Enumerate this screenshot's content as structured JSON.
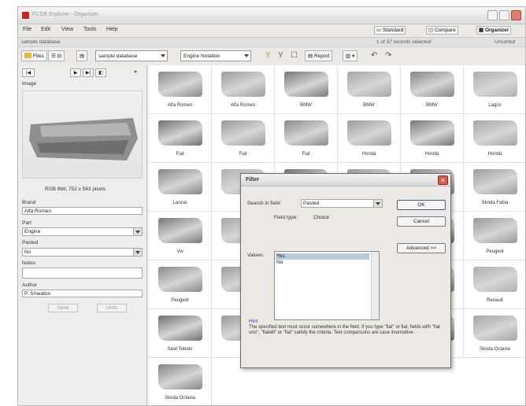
{
  "window": {
    "title": "FCDB Explorer - Organizer"
  },
  "menu": [
    "File",
    "Edit",
    "View",
    "Tools",
    "Help"
  ],
  "views": {
    "standard": "Standard",
    "compare": "Compare",
    "organizer": "Organizer"
  },
  "status": {
    "left": "sample database",
    "selection": "1 of 37 records selected",
    "sort": "Unsorted"
  },
  "toolbar": {
    "files_label": "Files",
    "db_combo": "sample database",
    "field_combo": "Engine Notation",
    "report_label": "Report"
  },
  "left": {
    "image_label": "Image",
    "image_info": "RGB 8bit, 752 x 543 pixels",
    "brand_label": "Brand",
    "brand_value": "Alfa Romeo",
    "part_label": "Part",
    "part_value": "Engine",
    "pasted_label": "Pasted",
    "pasted_value": "No",
    "notes_label": "Notes",
    "notes_value": "",
    "author_label": "Author",
    "author_value": "P. Smeaton",
    "save_label": "Save",
    "undo_label": "Undo"
  },
  "thumbnails": [
    "Alfa Romeo",
    "Alfa Romeo",
    "BMW",
    "BMW",
    "BMW",
    "Lagos",
    "Fiat",
    "Fiat",
    "Fiat",
    "Honda",
    "Honda",
    "Honda",
    "Lancia",
    "",
    "",
    "",
    "",
    "Skoda Fabia",
    "Vw",
    "Sk",
    "",
    "",
    "",
    "Peugeot",
    "Peugeot",
    "Sk",
    "",
    "",
    "",
    "Renault",
    "Seat Toledo",
    "Sk",
    "",
    "",
    "",
    "Skoda Octavia",
    "Skoda Octavia"
  ],
  "dialog": {
    "title": "Filter",
    "search_label": "Search in field:",
    "search_value": "Pasted",
    "field_type_label": "Field type:",
    "field_type_value": "Choice",
    "values_label": "Values:",
    "values": [
      "Yes",
      "No"
    ],
    "ok": "OK",
    "cancel": "Cancel",
    "advanced": "Advanced >>",
    "help_title": "Hint",
    "help_text": "The specified text must occur somewhere in the field. If you type \"fiat\" or fiat, fields with \"fiat uno\", \"fiatelli\" or \"fiat\" satisfy the criteria. Text comparisons are case insensitive."
  }
}
